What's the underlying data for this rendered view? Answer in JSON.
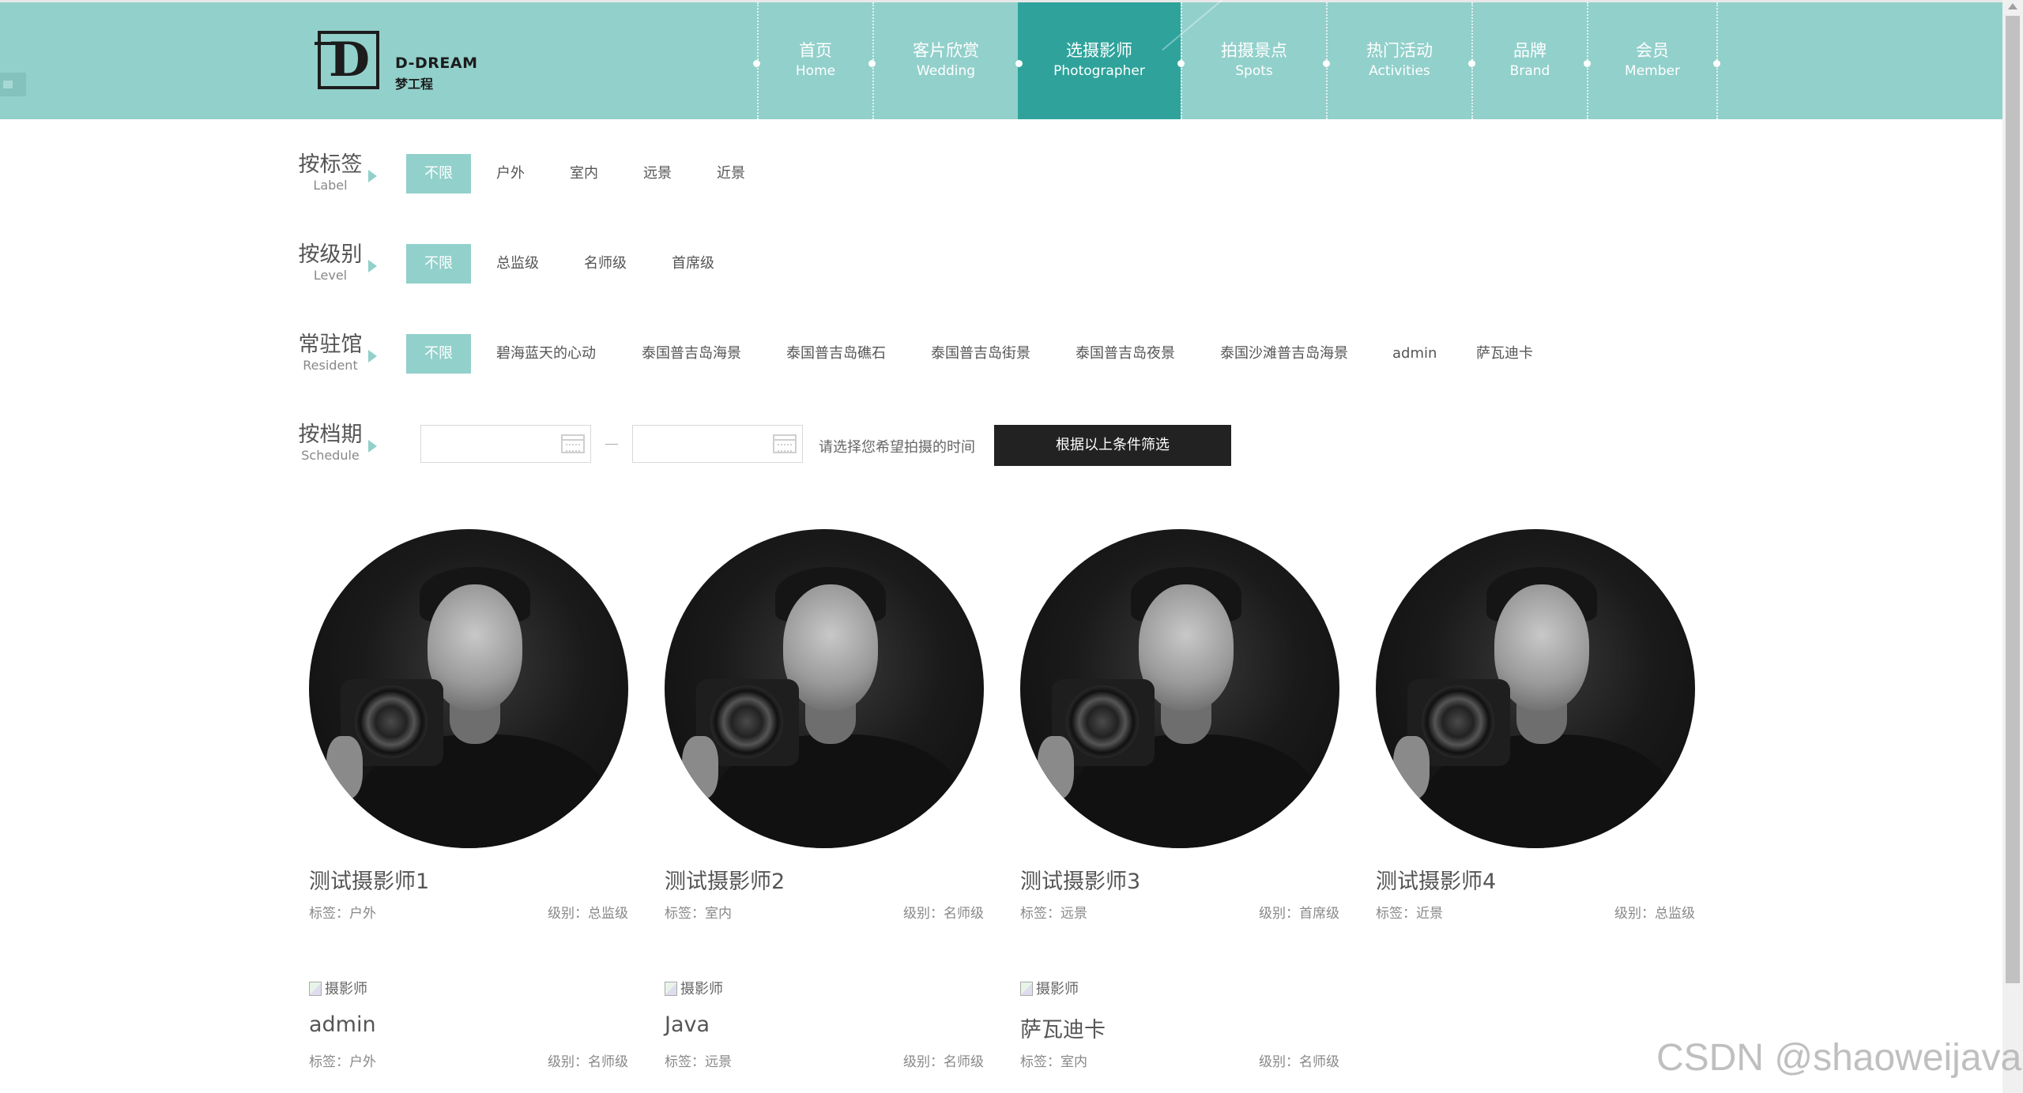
{
  "header": {
    "logo": {
      "en": "D-DREAM",
      "cn": "梦工程"
    },
    "nav": [
      {
        "cn": "首页",
        "en": "Home"
      },
      {
        "cn": "客片欣赏",
        "en": "Wedding"
      },
      {
        "cn": "选摄影师",
        "en": "Photographer",
        "active": true
      },
      {
        "cn": "拍摄景点",
        "en": "Spots"
      },
      {
        "cn": "热门活动",
        "en": "Activities"
      },
      {
        "cn": "品牌",
        "en": "Brand"
      },
      {
        "cn": "会员",
        "en": "Member"
      }
    ]
  },
  "filters": {
    "label": {
      "cn": "按标签",
      "en": "Label",
      "options": [
        "不限",
        "户外",
        "室内",
        "远景",
        "近景"
      ]
    },
    "level": {
      "cn": "按级别",
      "en": "Level",
      "options": [
        "不限",
        "总监级",
        "名师级",
        "首席级"
      ]
    },
    "resident": {
      "cn": "常驻馆",
      "en": "Resident",
      "options": [
        "不限",
        "碧海蓝天的心动",
        "泰国普吉岛海景",
        "泰国普吉岛礁石",
        "泰国普吉岛街景",
        "泰国普吉岛夜景",
        "泰国沙滩普吉岛海景",
        "admin",
        "萨瓦迪卡"
      ]
    },
    "schedule": {
      "cn": "按档期",
      "en": "Schedule",
      "start_value": "",
      "end_value": "",
      "hint": "请选择您希望拍摄的时间",
      "button": "根据以上条件筛选"
    }
  },
  "photographers": [
    {
      "name": "测试摄影师1",
      "tag_label": "标签：",
      "tag": "户外",
      "level_label": "级别：",
      "level": "总监级",
      "has_photo": true
    },
    {
      "name": "测试摄影师2",
      "tag_label": "标签：",
      "tag": "室内",
      "level_label": "级别：",
      "level": "名师级",
      "has_photo": true
    },
    {
      "name": "测试摄影师3",
      "tag_label": "标签：",
      "tag": "远景",
      "level_label": "级别：",
      "level": "首席级",
      "has_photo": true
    },
    {
      "name": "测试摄影师4",
      "tag_label": "标签：",
      "tag": "近景",
      "level_label": "级别：",
      "level": "总监级",
      "has_photo": true
    },
    {
      "name": "admin",
      "tag_label": "标签：",
      "tag": "户外",
      "level_label": "级别：",
      "level": "名师级",
      "has_photo": false,
      "alt": "摄影师"
    },
    {
      "name": "Java",
      "tag_label": "标签：",
      "tag": "远景",
      "level_label": "级别：",
      "level": "名师级",
      "has_photo": false,
      "alt": "摄影师"
    },
    {
      "name": "萨瓦迪卡",
      "tag_label": "标签：",
      "tag": "室内",
      "level_label": "级别：",
      "level": "名师级",
      "has_photo": false,
      "alt": "摄影师"
    }
  ],
  "watermark": "CSDN @shaoweijava",
  "colors": {
    "header": "#92d0cb",
    "nav_active": "#2fa39b",
    "button": "#222222"
  }
}
